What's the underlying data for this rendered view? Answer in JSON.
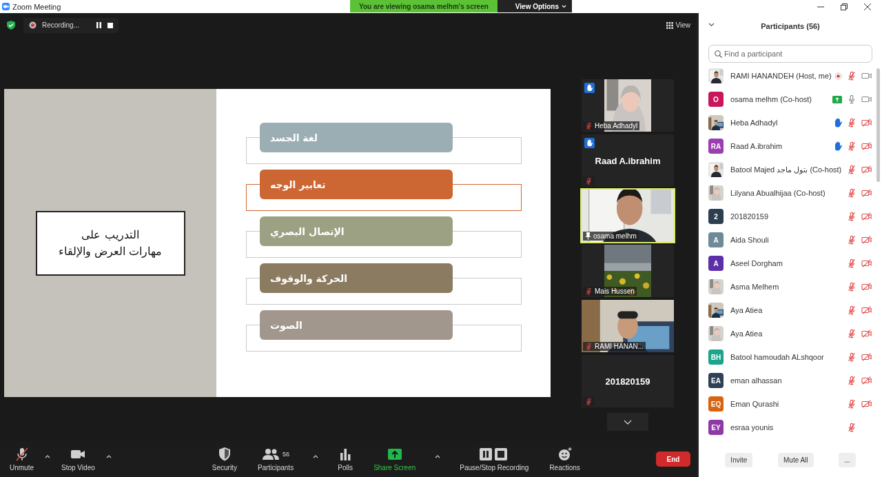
{
  "window": {
    "title": "Zoom Meeting"
  },
  "banner": {
    "text": "You are viewing osama melhm's screen",
    "options": "View Options"
  },
  "recording": {
    "label": "Recording..."
  },
  "view_button": {
    "label": "View"
  },
  "slide": {
    "title": "التدريب على\nمهارات العرض والإلقاء",
    "items": [
      {
        "label": "لغة الجسد",
        "color": "#9aaeb3",
        "accent": false
      },
      {
        "label": "تعابير الوجه",
        "color": "#cc6633",
        "accent": true
      },
      {
        "label": "الإتصال البصري",
        "color": "#9da184",
        "accent": false
      },
      {
        "label": "الحركة والوقوف",
        "color": "#8b7b60",
        "accent": false
      },
      {
        "label": "الصوت",
        "color": "#a2978d",
        "accent": false
      }
    ]
  },
  "thumbnails": [
    {
      "name": "Heba Adhadyl",
      "kind": "picture",
      "hand_raised": true,
      "muted": true,
      "pinned": false,
      "speaking": false
    },
    {
      "name": "Raad A.ibrahim",
      "kind": "name",
      "hand_raised": true,
      "muted": true,
      "pinned": false,
      "speaking": false
    },
    {
      "name": "osama melhm",
      "kind": "picture",
      "hand_raised": false,
      "muted": false,
      "pinned": true,
      "speaking": true
    },
    {
      "name": "Mais Hussen",
      "kind": "picture",
      "hand_raised": false,
      "muted": true,
      "pinned": false,
      "speaking": false
    },
    {
      "name": "RAMI HANAN...",
      "kind": "picture",
      "hand_raised": false,
      "muted": true,
      "pinned": false,
      "speaking": false
    },
    {
      "name": "201820159",
      "kind": "name",
      "hand_raised": false,
      "muted": true,
      "pinned": false,
      "speaking": false
    }
  ],
  "toolbar": {
    "items": [
      {
        "label": "Unmute",
        "kind": "microphone",
        "caret": true
      },
      {
        "label": "Stop Video",
        "kind": "camera",
        "caret": true
      },
      {
        "label": "Security",
        "kind": "security",
        "caret": false
      },
      {
        "label": "Participants",
        "kind": "participants",
        "caret": true,
        "count": "56"
      },
      {
        "label": "Polls",
        "kind": "polls",
        "caret": false
      },
      {
        "label": "Share Screen",
        "kind": "share",
        "caret": true
      },
      {
        "label": "Pause/Stop Recording",
        "kind": "record",
        "caret": false
      },
      {
        "label": "Reactions",
        "kind": "reactions",
        "caret": false
      }
    ],
    "end": "End"
  },
  "participants": {
    "title": "Participants (56)",
    "search": {
      "placeholder": "Find a participant"
    },
    "items": [
      {
        "name": "RAMI HANANDEH (Host, me)",
        "kind": "picture",
        "recording": true,
        "sharing": false,
        "hand_raised": false,
        "muted": true,
        "video_off": false
      },
      {
        "name": "osama melhm (Co-host)",
        "kind": "initials",
        "initials": "O",
        "color": "#c8175d",
        "recording": false,
        "sharing": true,
        "hand_raised": false,
        "muted": false,
        "video_off": false
      },
      {
        "name": "Heba Adhadyl",
        "kind": "picture",
        "recording": false,
        "sharing": false,
        "hand_raised": true,
        "muted": true,
        "video_off": true
      },
      {
        "name": "Raad A.ibrahim",
        "kind": "initials",
        "initials": "RA",
        "color": "#9b3fb0",
        "recording": false,
        "sharing": false,
        "hand_raised": true,
        "muted": true,
        "video_off": true
      },
      {
        "name": "Batool Majed بتول ماجد (Co-host)",
        "kind": "picture",
        "recording": false,
        "sharing": false,
        "hand_raised": false,
        "muted": true,
        "video_off": true
      },
      {
        "name": "Lilyana Abualhijaa (Co-host)",
        "kind": "picture",
        "recording": false,
        "sharing": false,
        "hand_raised": false,
        "muted": true,
        "video_off": true
      },
      {
        "name": "201820159",
        "kind": "initials",
        "initials": "2",
        "color": "#2d3e50",
        "recording": false,
        "sharing": false,
        "hand_raised": false,
        "muted": true,
        "video_off": true
      },
      {
        "name": "Aida Shouli",
        "kind": "initials",
        "initials": "A",
        "color": "#6e8a99",
        "recording": false,
        "sharing": false,
        "hand_raised": false,
        "muted": true,
        "video_off": true
      },
      {
        "name": "Aseel Dorgham",
        "kind": "initials",
        "initials": "A",
        "color": "#5b2fa8",
        "recording": false,
        "sharing": false,
        "hand_raised": false,
        "muted": true,
        "video_off": true
      },
      {
        "name": "Asma Melhem",
        "kind": "picture",
        "recording": false,
        "sharing": false,
        "hand_raised": false,
        "muted": true,
        "video_off": true
      },
      {
        "name": "Aya Atiea",
        "kind": "picture",
        "recording": false,
        "sharing": false,
        "hand_raised": false,
        "muted": true,
        "video_off": true
      },
      {
        "name": "Aya Atiea",
        "kind": "picture",
        "recording": false,
        "sharing": false,
        "hand_raised": false,
        "muted": true,
        "video_off": true
      },
      {
        "name": "Batool hamoudah ALshqoor",
        "kind": "initials",
        "initials": "BH",
        "color": "#1aa58c",
        "recording": false,
        "sharing": false,
        "hand_raised": false,
        "muted": true,
        "video_off": true
      },
      {
        "name": "eman alhassan",
        "kind": "initials",
        "initials": "EA",
        "color": "#2e4157",
        "recording": false,
        "sharing": false,
        "hand_raised": false,
        "muted": true,
        "video_off": true
      },
      {
        "name": "Eman Qurashi",
        "kind": "initials",
        "initials": "EQ",
        "color": "#d9640f",
        "recording": false,
        "sharing": false,
        "hand_raised": false,
        "muted": true,
        "video_off": true
      },
      {
        "name": "esraa younis",
        "kind": "initials",
        "initials": "EY",
        "color": "#8e3aa6",
        "recording": false,
        "sharing": false,
        "hand_raised": false,
        "muted": true
      }
    ],
    "buttons": [
      "Invite",
      "Mute All",
      "..."
    ]
  }
}
